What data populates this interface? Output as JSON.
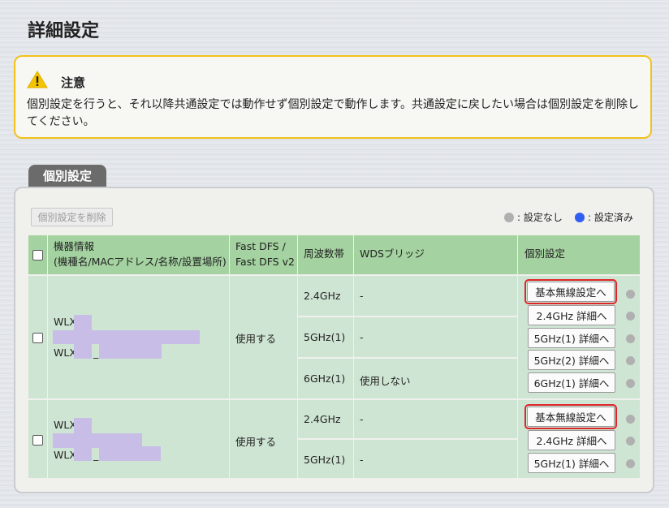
{
  "page": {
    "title": "詳細設定"
  },
  "notice": {
    "icon": "warning-icon",
    "title": "注意",
    "body": "個別設定を行うと、それ以降共通設定では動作せず個別設定で動作します。共通設定に戻したい場合は個別設定を削除してください。"
  },
  "section": {
    "tab_label": "個別設定"
  },
  "toolbar": {
    "delete_label": "個別設定を削除"
  },
  "legend": {
    "unset_label": ": 設定なし",
    "unset_color": "#b0b0b0",
    "set_label": ": 設定済み",
    "set_color": "#2f5ef2"
  },
  "table": {
    "headers": {
      "device_line1": "機器情報",
      "device_line2": "(機種名/MACアドレス/名称/設置場所)",
      "fastdfs_line1": "Fast DFS /",
      "fastdfs_line2": "Fast DFS v2",
      "band": "周波数帯",
      "wds": "WDSブリッジ",
      "individual": "個別設定"
    },
    "rows": [
      {
        "device_line1": "WLX",
        "device_line2": "WLX",
        "device_line2_suffix": "_",
        "fast_dfs": "使用する",
        "bands": [
          {
            "band": "2.4GHz",
            "wds": "-"
          },
          {
            "band": "5GHz(1)",
            "wds": "-"
          },
          {
            "band": "6GHz(1)",
            "wds": "使用しない"
          }
        ],
        "buttons": [
          "基本無線設定へ",
          "2.4GHz 詳細へ",
          "5GHz(1) 詳細へ",
          "5GHz(2) 詳細へ",
          "6GHz(1) 詳細へ"
        ]
      },
      {
        "device_line1": "WLX",
        "device_line2": "WLX",
        "device_line2_suffix": "_",
        "fast_dfs": "使用する",
        "bands": [
          {
            "band": "2.4GHz",
            "wds": "-"
          },
          {
            "band": "5GHz(1)",
            "wds": "-"
          }
        ],
        "buttons": [
          "基本無線設定へ",
          "2.4GHz 詳細へ",
          "5GHz(1) 詳細へ"
        ]
      }
    ]
  }
}
